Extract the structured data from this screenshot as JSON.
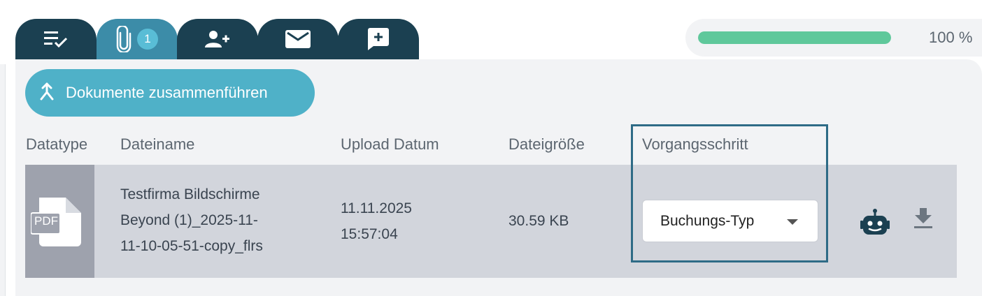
{
  "tabs": [
    {
      "icon": "checklist-icon"
    },
    {
      "icon": "paperclip-icon",
      "badge": "1",
      "active": true
    },
    {
      "icon": "add-person-icon"
    },
    {
      "icon": "mail-icon"
    },
    {
      "icon": "add-comment-icon"
    }
  ],
  "progress": {
    "value": 1.0,
    "label": "100 %",
    "color": "#5fc89b"
  },
  "toolbar": {
    "merge_label": "Dokumente zusammenführen",
    "merge_icon": "merge-arrow-icon"
  },
  "table": {
    "headers": [
      "Datatype",
      "Dateiname",
      "Upload Datum",
      "Dateigröße",
      "Vorgangsschritt"
    ],
    "rows": [
      {
        "type_icon": "pdf-file-icon",
        "type_label": "PDF",
        "filename_lines": [
          "Testfirma Bildschirme",
          "Beyond (1)_2025-11-",
          "11-10-05-51-copy_flrs"
        ],
        "upload_date": "11.11.2025",
        "upload_time": "15:57:04",
        "size": "30.59 KB",
        "step_select": "Buchungs-Typ",
        "actions": [
          "robot-icon",
          "download-icon"
        ]
      }
    ]
  },
  "colors": {
    "tab": "#1b4051",
    "tab_active": "#3c8ca8",
    "accent": "#4fb1c8",
    "highlight_border": "#2e6b86"
  }
}
